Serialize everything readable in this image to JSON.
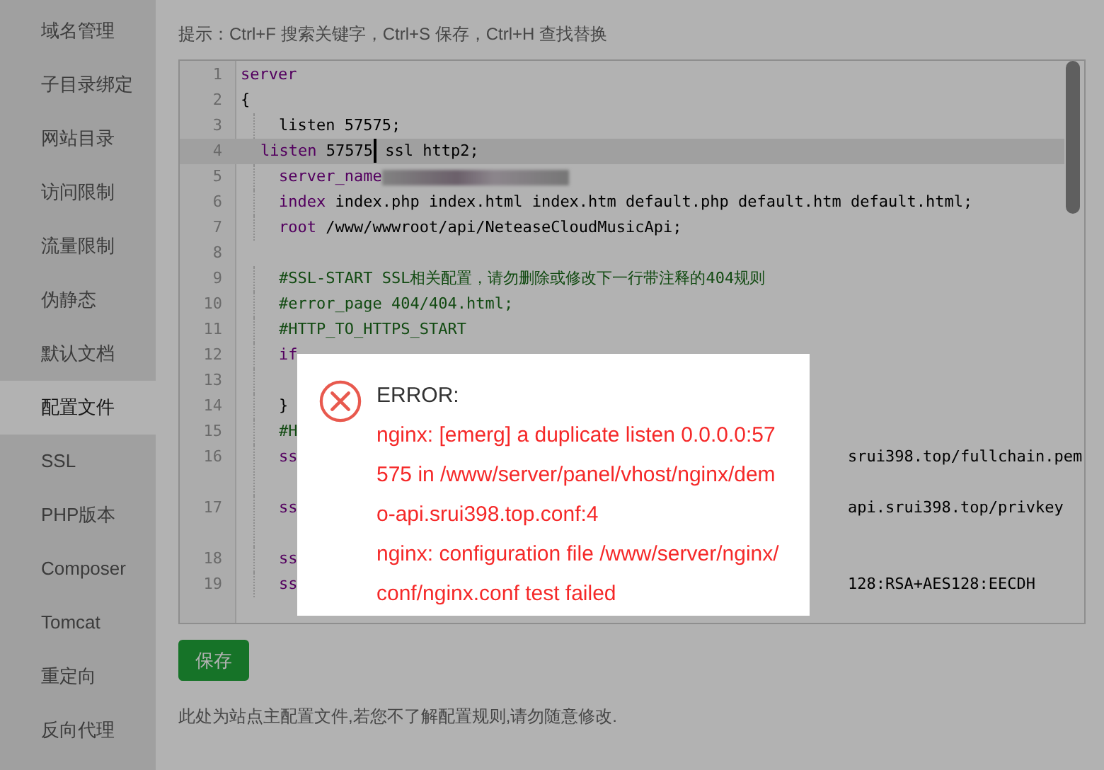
{
  "sidebar": {
    "items": [
      {
        "label": "域名管理",
        "selected": false
      },
      {
        "label": "子目录绑定",
        "selected": false
      },
      {
        "label": "网站目录",
        "selected": false
      },
      {
        "label": "访问限制",
        "selected": false
      },
      {
        "label": "流量限制",
        "selected": false
      },
      {
        "label": "伪静态",
        "selected": false
      },
      {
        "label": "默认文档",
        "selected": false
      },
      {
        "label": "配置文件",
        "selected": true
      },
      {
        "label": "SSL",
        "selected": false
      },
      {
        "label": "PHP版本",
        "selected": false
      },
      {
        "label": "Composer",
        "selected": false
      },
      {
        "label": "Tomcat",
        "selected": false
      },
      {
        "label": "重定向",
        "selected": false
      },
      {
        "label": "反向代理",
        "selected": false
      }
    ]
  },
  "hint": "提示：Ctrl+F 搜索关键字，Ctrl+S 保存，Ctrl+H 查找替换",
  "editor": {
    "lines": [
      {
        "num": "1",
        "kind": "flush",
        "active": false,
        "wrapped": false,
        "segments": [
          {
            "kind": "keyword",
            "t": "server"
          }
        ]
      },
      {
        "num": "2",
        "kind": "flush",
        "active": false,
        "wrapped": false,
        "segments": [
          {
            "kind": "plain",
            "t": "{"
          }
        ]
      },
      {
        "num": "3",
        "kind": "indented",
        "active": false,
        "wrapped": false,
        "segments": [
          {
            "kind": "plain",
            "t": "listen 57575;"
          }
        ]
      },
      {
        "num": "4",
        "kind": "half_indented",
        "active": true,
        "wrapped": false,
        "segments": [
          {
            "kind": "keyword",
            "t": "listen"
          },
          {
            "kind": "plain",
            "t": " 57575"
          },
          {
            "kind": "cursor"
          },
          {
            "kind": "plain",
            "t": " ssl http2;"
          }
        ]
      },
      {
        "num": "5",
        "kind": "indented",
        "active": false,
        "wrapped": false,
        "segments": [
          {
            "kind": "keyword",
            "t": "server_name"
          },
          {
            "kind": "redacted"
          }
        ]
      },
      {
        "num": "6",
        "kind": "indented",
        "active": false,
        "wrapped": false,
        "segments": [
          {
            "kind": "keyword",
            "t": "index"
          },
          {
            "kind": "plain",
            "t": " index.php index.html index.htm default.php default.htm default.html;"
          }
        ]
      },
      {
        "num": "7",
        "kind": "indented",
        "active": false,
        "wrapped": false,
        "segments": [
          {
            "kind": "keyword",
            "t": "root"
          },
          {
            "kind": "plain",
            "t": " /www/wwwroot/api/NeteaseCloudMusicApi;"
          }
        ]
      },
      {
        "num": "8",
        "kind": "flush",
        "active": false,
        "wrapped": false
      },
      {
        "num": "9",
        "kind": "indented",
        "active": false,
        "wrapped": false,
        "segments": [
          {
            "kind": "comment",
            "t": "#SSL-START SSL相关配置，请勿删除或修改下一行带注释的404规则"
          }
        ]
      },
      {
        "num": "10",
        "kind": "indented",
        "active": false,
        "wrapped": false,
        "segments": [
          {
            "kind": "comment",
            "t": "#error_page 404/404.html;"
          }
        ]
      },
      {
        "num": "11",
        "kind": "indented",
        "active": false,
        "wrapped": false,
        "segments": [
          {
            "kind": "comment",
            "t": "#HTTP_TO_HTTPS_START"
          }
        ]
      },
      {
        "num": "12",
        "kind": "indented",
        "active": false,
        "wrapped": false,
        "segments": [
          {
            "kind": "keyword",
            "t": "if"
          }
        ]
      },
      {
        "num": "13",
        "kind": "indented",
        "active": false,
        "wrapped": false
      },
      {
        "num": "14",
        "kind": "indented",
        "active": false,
        "wrapped": false,
        "segments": [
          {
            "kind": "plain",
            "t": "}"
          }
        ]
      },
      {
        "num": "15",
        "kind": "indented",
        "active": false,
        "wrapped": false,
        "segments": [
          {
            "kind": "comment",
            "t": "#H"
          }
        ]
      },
      {
        "num": "16",
        "kind": "indented",
        "active": false,
        "wrapped": true,
        "segments": [
          {
            "kind": "keyword",
            "t": "ss"
          }
        ],
        "tail": "srui398.top/fullchain.pem"
      },
      {
        "num": "17",
        "kind": "indented",
        "active": false,
        "wrapped": true,
        "segments": [
          {
            "kind": "keyword",
            "t": "ss"
          }
        ],
        "tail": "api.srui398.top/privkey"
      },
      {
        "num": "18",
        "kind": "indented",
        "active": false,
        "wrapped": false,
        "segments": [
          {
            "kind": "keyword",
            "t": "ss"
          }
        ]
      },
      {
        "num": "19",
        "kind": "indented",
        "active": false,
        "wrapped": false,
        "segments": [
          {
            "kind": "keyword",
            "t": "ss"
          }
        ],
        "tail": "128:RSA+AES128:EECDH"
      }
    ]
  },
  "save_button": "保存",
  "note": "此处为站点主配置文件,若您不了解配置规则,请勿随意修改.",
  "dialog": {
    "title": "ERROR:",
    "messages": [
      "nginx: [emerg] a duplicate listen 0.0.0.0:57575 in /www/server/panel/vhost/nginx/demo-api.srui398.top.conf:4",
      "nginx: configuration file /www/server/nginx/conf/nginx.conf test failed"
    ]
  }
}
